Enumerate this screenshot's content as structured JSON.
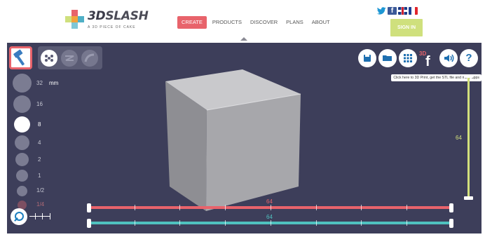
{
  "header": {
    "logo_text_a": "3D",
    "logo_text_b": "SLASH",
    "logo_tagline": "A 3D PIECE OF CAKE",
    "nav": [
      "CREATE",
      "PRODUCTS",
      "DISCOVER",
      "PLANS",
      "ABOUT"
    ],
    "nav_active": "CREATE",
    "signin_label": "SIGN IN",
    "logo_colors": [
      "#4fb0c6",
      "#e8636b",
      "#cfe07d",
      "#f2a33c"
    ]
  },
  "tools": {
    "active_tool_icon": "hammer-icon",
    "group_icons": [
      "dots-pattern-icon",
      "zigzag-icon",
      "curve-icon"
    ]
  },
  "sizes": {
    "unit": "mm",
    "items": [
      "32",
      "16",
      "8",
      "4",
      "2",
      "1",
      "1/2",
      "1/4"
    ],
    "selected": "8"
  },
  "toolbar_right": {
    "icons": [
      "save-icon",
      "open-folder-icon",
      "grid-icon",
      "facebook-3d-icon",
      "sound-icon",
      "help-icon"
    ],
    "tooltip": "Click here to 3D Print, get the STL file and more apps"
  },
  "sliders": {
    "vertical_value": "64",
    "red_value": "64",
    "teal_value": "64",
    "red_color": "#e8636b",
    "teal_color": "#4fc1bf",
    "vertical_color": "#d2e07c",
    "vertical_level": 1.0,
    "red_level": 1.0,
    "teal_level": 1.0
  },
  "colors": {
    "workspace_bg": "#3d3e5a",
    "accent": "#e8636b"
  }
}
